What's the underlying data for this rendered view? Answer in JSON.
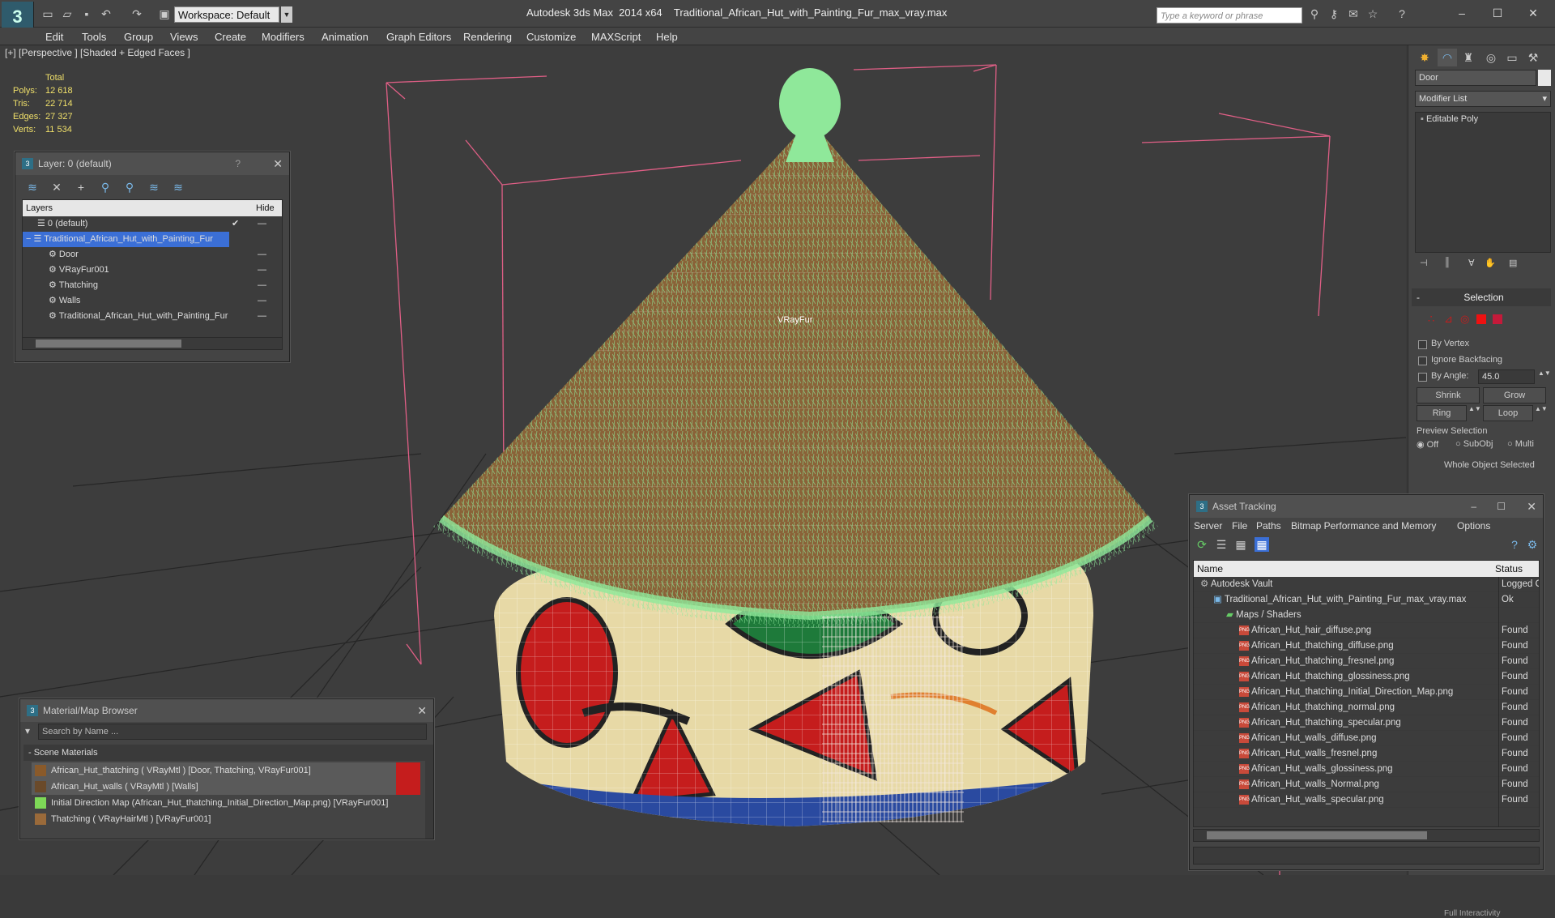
{
  "window": {
    "app_title": "Autodesk 3ds Max  2014 x64",
    "file_title": "Traditional_African_Hut_with_Painting_Fur_max_vray.max",
    "workspace": "Workspace: Default",
    "search_placeholder": "Type a keyword or phrase"
  },
  "menu": [
    "Edit",
    "Tools",
    "Group",
    "Views",
    "Create",
    "Modifiers",
    "Animation",
    "Graph Editors",
    "Rendering",
    "Customize",
    "MAXScript",
    "Help"
  ],
  "viewport": {
    "label": "[+] [Perspective ] [Shaded + Edged Faces ]",
    "object_label": "VRayFur",
    "stats": {
      "header": "Total",
      "rows": [
        {
          "key": "Polys:",
          "value": "12 618"
        },
        {
          "key": "Tris:",
          "value": "22 714"
        },
        {
          "key": "Edges:",
          "value": "27 327"
        },
        {
          "key": "Verts:",
          "value": "11 534"
        }
      ]
    }
  },
  "layer_panel": {
    "title": "Layer: 0 (default)",
    "help": "?",
    "col_layers": "Layers",
    "col_hide": "Hide",
    "rows": [
      {
        "label": "0 (default)",
        "indent": 0,
        "selected": false,
        "checked": true
      },
      {
        "label": "Traditional_African_Hut_with_Painting_Fur",
        "indent": 0,
        "selected": true,
        "checked": false
      },
      {
        "label": "Door",
        "indent": 1,
        "selected": false,
        "checked": false
      },
      {
        "label": "VRayFur001",
        "indent": 1,
        "selected": false,
        "checked": false
      },
      {
        "label": "Thatching",
        "indent": 1,
        "selected": false,
        "checked": false
      },
      {
        "label": "Walls",
        "indent": 1,
        "selected": false,
        "checked": false
      },
      {
        "label": "Traditional_African_Hut_with_Painting_Fur",
        "indent": 1,
        "selected": false,
        "checked": false
      }
    ]
  },
  "material_browser": {
    "title": "Material/Map Browser",
    "search_placeholder": "Search by Name ...",
    "section": "- Scene Materials",
    "items": [
      {
        "label": "African_Hut_thatching  ( VRayMtl ) [Door, Thatching, VRayFur001]",
        "swatch": "#8a5a2a",
        "flag": true
      },
      {
        "label": "African_Hut_walls  ( VRayMtl ) [Walls]",
        "swatch": "#6a4a2a",
        "flag": true
      },
      {
        "label": "Initial Direction Map (African_Hut_thatching_Initial_Direction_Map.png) [VRayFur001]",
        "swatch": "#7ed957",
        "flag": false
      },
      {
        "label": "Thatching  ( VRayHairMtl ) [VRayFur001]",
        "swatch": "#9a6a3a",
        "flag": false
      }
    ]
  },
  "command_panel": {
    "object_name": "Door",
    "modifier_list": "Modifier List",
    "stack_item": "Editable Poly",
    "selection_header": "Selection",
    "by_vertex": "By Vertex",
    "ignore_backfacing": "Ignore Backfacing",
    "by_angle": "By Angle:",
    "angle_value": "45.0",
    "shrink": "Shrink",
    "grow": "Grow",
    "ring": "Ring",
    "loop": "Loop",
    "preview_selection": "Preview Selection",
    "preview_off": "Off",
    "preview_subobj": "SubObj",
    "preview_multi": "Multi",
    "status": "Whole Object Selected",
    "bottom_hint": "Full Interactivity"
  },
  "asset_tracking": {
    "title": "Asset Tracking",
    "menus": [
      "Server",
      "File",
      "Paths",
      "Bitmap Performance and Memory",
      "Options"
    ],
    "col_name": "Name",
    "col_status": "Status",
    "rows": [
      {
        "name": "Autodesk Vault",
        "status": "Logged O",
        "indent": 1,
        "kind": "vault"
      },
      {
        "name": "Traditional_African_Hut_with_Painting_Fur_max_vray.max",
        "status": "Ok",
        "indent": 2,
        "kind": "max"
      },
      {
        "name": "Maps / Shaders",
        "status": "",
        "indent": 3,
        "kind": "folder"
      },
      {
        "name": "African_Hut_hair_diffuse.png",
        "status": "Found",
        "indent": 4,
        "kind": "png"
      },
      {
        "name": "African_Hut_thatching_diffuse.png",
        "status": "Found",
        "indent": 4,
        "kind": "png"
      },
      {
        "name": "African_Hut_thatching_fresnel.png",
        "status": "Found",
        "indent": 4,
        "kind": "png"
      },
      {
        "name": "African_Hut_thatching_glossiness.png",
        "status": "Found",
        "indent": 4,
        "kind": "png"
      },
      {
        "name": "African_Hut_thatching_Initial_Direction_Map.png",
        "status": "Found",
        "indent": 4,
        "kind": "png"
      },
      {
        "name": "African_Hut_thatching_normal.png",
        "status": "Found",
        "indent": 4,
        "kind": "png"
      },
      {
        "name": "African_Hut_thatching_specular.png",
        "status": "Found",
        "indent": 4,
        "kind": "png"
      },
      {
        "name": "African_Hut_walls_diffuse.png",
        "status": "Found",
        "indent": 4,
        "kind": "png"
      },
      {
        "name": "African_Hut_walls_fresnel.png",
        "status": "Found",
        "indent": 4,
        "kind": "png"
      },
      {
        "name": "African_Hut_walls_glossiness.png",
        "status": "Found",
        "indent": 4,
        "kind": "png"
      },
      {
        "name": "African_Hut_walls_Normal.png",
        "status": "Found",
        "indent": 4,
        "kind": "png"
      },
      {
        "name": "African_Hut_walls_specular.png",
        "status": "Found",
        "indent": 4,
        "kind": "png"
      }
    ]
  },
  "colors": {
    "selection": "#3b6fd6",
    "fur": "#8fe89a",
    "thatch": "#8a6238",
    "wall": "#e7d9a6"
  }
}
